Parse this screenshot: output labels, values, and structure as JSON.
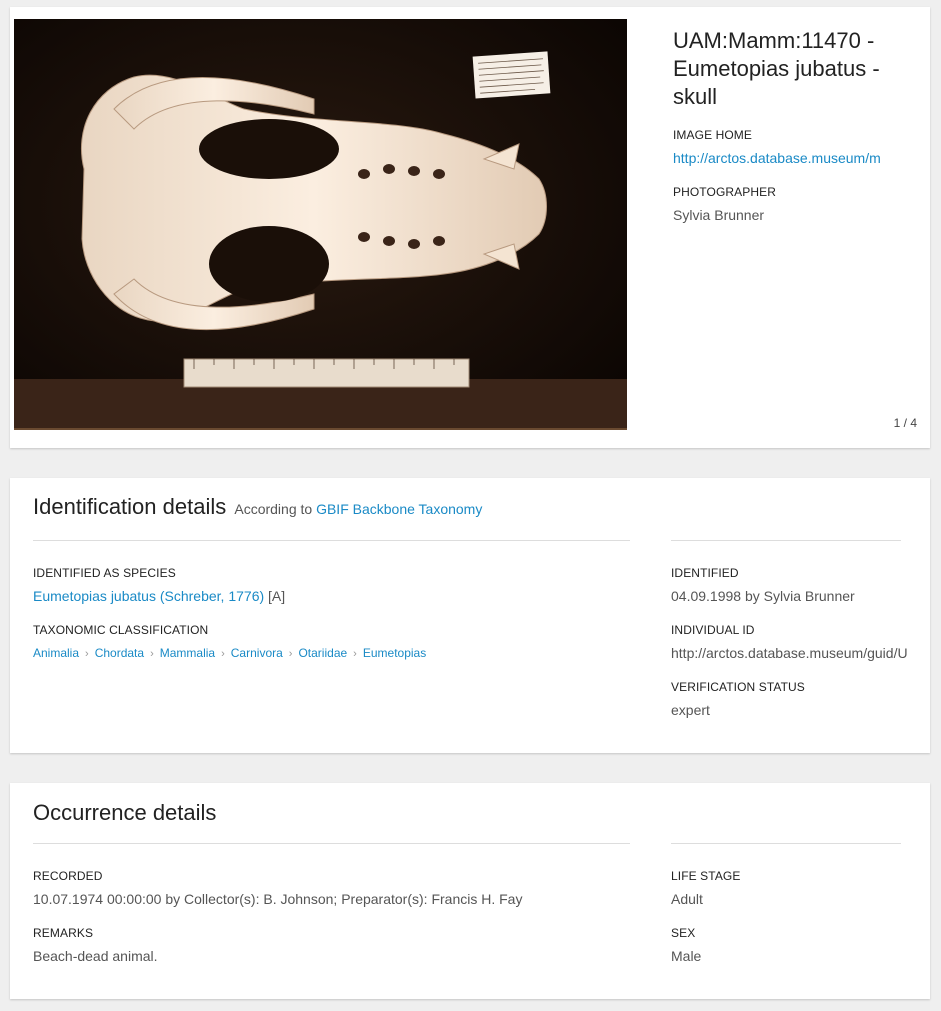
{
  "image_card": {
    "title": "UAM:Mamm:11470 - Eumetopias jubatus - skull",
    "image_home_label": "IMAGE HOME",
    "image_home_url": "http://arctos.database.museum/m",
    "photographer_label": "PHOTOGRAPHER",
    "photographer": "Sylvia Brunner",
    "pager": "1 / 4",
    "photo_alt": "Photograph of sea lion skull (ventral view) with ruler and specimen label"
  },
  "identification": {
    "title": "Identification details",
    "according_to_prefix": "According to",
    "according_to_link": "GBIF Backbone Taxonomy",
    "identified_as_label": "IDENTIFIED AS SPECIES",
    "species_link": "Eumetopias jubatus (Schreber, 1776)",
    "species_suffix": "[A]",
    "classification_label": "TAXONOMIC CLASSIFICATION",
    "classification": [
      "Animalia",
      "Chordata",
      "Mammalia",
      "Carnivora",
      "Otariidae",
      "Eumetopias"
    ],
    "separator": "›",
    "identified_label": "IDENTIFIED",
    "identified_value": "04.09.1998 by Sylvia Brunner",
    "individual_id_label": "INDIVIDUAL ID",
    "individual_id_value": "http://arctos.database.museum/guid/U",
    "verification_label": "VERIFICATION STATUS",
    "verification_value": "expert"
  },
  "occurrence": {
    "title": "Occurrence details",
    "recorded_label": "RECORDED",
    "recorded_value": "10.07.1974 00:00:00 by Collector(s): B. Johnson; Preparator(s): Francis H. Fay",
    "remarks_label": "REMARKS",
    "remarks_value": "Beach-dead animal.",
    "life_stage_label": "LIFE STAGE",
    "life_stage_value": "Adult",
    "sex_label": "SEX",
    "sex_value": "Male"
  }
}
